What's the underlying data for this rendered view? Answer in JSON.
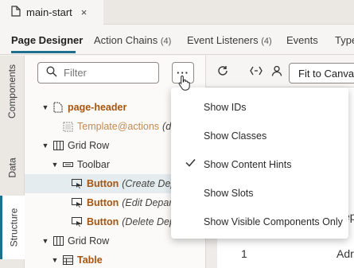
{
  "file_tab": {
    "title": "main-start",
    "close": "×"
  },
  "subtabs": [
    {
      "label": "Page Designer",
      "count": ""
    },
    {
      "label": "Action Chains",
      "count": "(4)"
    },
    {
      "label": "Event Listeners",
      "count": "(4)"
    },
    {
      "label": "Events",
      "count": ""
    },
    {
      "label": "Type",
      "count": ""
    }
  ],
  "rail": {
    "components": "Components",
    "data": "Data",
    "structure": "Structure"
  },
  "filter": {
    "placeholder": "Filter"
  },
  "more_button": {
    "label": "···"
  },
  "tree": {
    "page_header": "page-header",
    "template": "Template",
    "template_at": "@actions",
    "template_tail": "(d",
    "grid_row_1": "Grid Row",
    "toolbar": "Toolbar",
    "button1": "Button",
    "button1_hint": "(Create Dep",
    "button2": "Button",
    "button2_hint": "(Edit Depar",
    "button3": "Button",
    "button3_hint": "(Delete Dep",
    "grid_row_2": "Grid Row",
    "table": "Table"
  },
  "canvas": {
    "fit_label": "Fit to Canvas",
    "row_num": "1",
    "row_text": "Adr",
    "side_text": "ep"
  },
  "menu": {
    "items": [
      {
        "label": "Show IDs",
        "checked": false
      },
      {
        "label": "Show Classes",
        "checked": false
      },
      {
        "label": "Show Content Hints",
        "checked": true
      },
      {
        "label": "Show Slots",
        "checked": false
      },
      {
        "label": "Show Visible Components Only",
        "checked": false
      }
    ]
  },
  "colors": {
    "accent": "#1f6f8f",
    "component_label": "#a8540b"
  }
}
